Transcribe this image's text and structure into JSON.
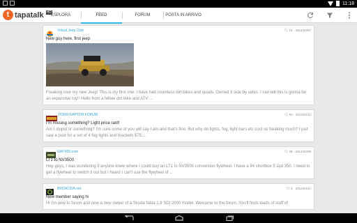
{
  "status": {
    "time": "11:18"
  },
  "app": {
    "logo_text": "tapatalk",
    "logo_badge": "HD",
    "tabs": [
      {
        "label": "ESPLORA"
      },
      {
        "label": "FEED"
      },
      {
        "label": "FORUM"
      },
      {
        "label": "POSTA IN ARRIVO"
      }
    ]
  },
  "feed": [
    {
      "forum": "Virtual Jeep Club",
      "comments": "15",
      "date": "2014/04/07",
      "title": "New guy here, first jeep",
      "body": "Freaking love my new Jeep! This is my first one, I have had countless dirt bikes and quads. Owned 3 side by sides. I can tell this is gonna be an expensive toy!! Hello from a fellow dirt bike and ATV ..."
    },
    {
      "forum": "FORD RAPTOR FORUM",
      "comments": "52",
      "date": "2014/04/11",
      "title": "I'm missing something? Light price rant!",
      "body": "Am I stupid or something? I'm sure some of you will say I am and that's fine. But why do lights, fog, light bars etc cost so freaking much? I just saw a post for a set of 4 fog lights and brackets $75 ..."
    },
    {
      "forum": "GM7400.com",
      "comments": "28",
      "date": "2014/04/08",
      "title": "LT1 to NV3500",
      "body": "Hey guys, I was wondering if anyone knew where I could buy an LT1 to NV3500 conversion flywheel. I have a 94 shortbox 5 spd 350. I need to get a flywheel to switch it out but I heard I can't use the flywheel of ..."
    },
    {
      "forum": "BRISKODA.net",
      "comments": "4",
      "date": "2014/04/11",
      "title": "New member saying hi",
      "body": "Hi I'm new to forum and new a new owner of a Skoda fabia 1.9 SDI 2000 model. Welcome to the forum. You'll finds loads of stuff of"
    }
  ]
}
